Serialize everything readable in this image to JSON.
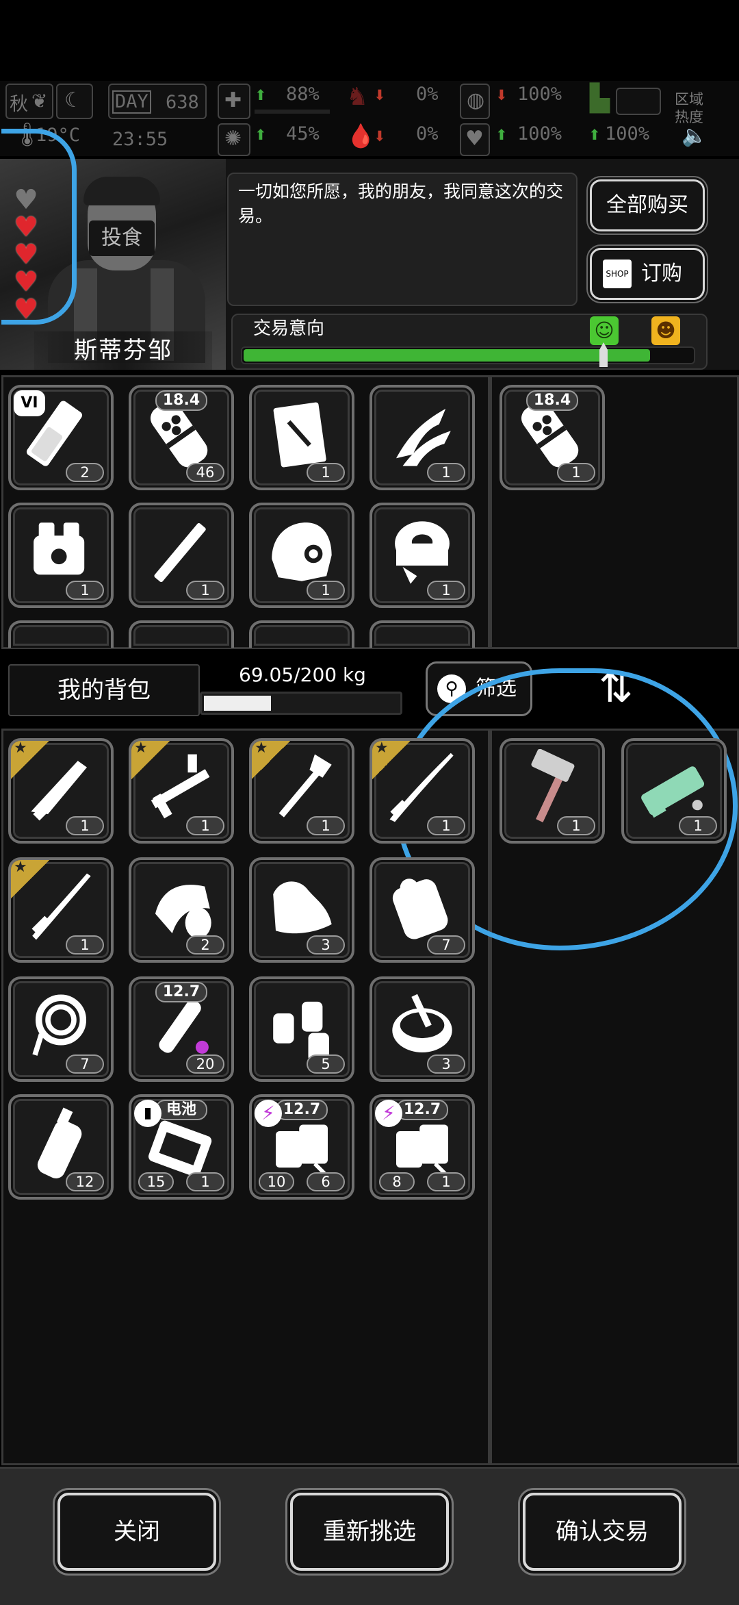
{
  "status": {
    "season": "秋",
    "day_label": "DAY",
    "day": "638",
    "temperature": "19°C",
    "clock": "23:55",
    "stats": {
      "health_pct": "88%",
      "mood_pct": "45%",
      "bleed_pct": "0%",
      "bleed2_pct": "0%",
      "food_pct": "100%",
      "water_pct": "100%",
      "stamina_pct": "100%"
    },
    "zone_label_1": "区域",
    "zone_label_2": "热度"
  },
  "merchant": {
    "name": "斯蒂芬邹",
    "mask_text": "投食",
    "hearts_filled": 4,
    "hearts_total": 5,
    "dialog": "一切如您所愿，我的朋友，我同意这次的交易。",
    "buy_all_label": "全部购买",
    "order_label": "订购",
    "order_icon_text": "SHOP",
    "intent_label": "交易意向",
    "intent_level": 0.9
  },
  "merchant_items": [
    {
      "name": "vial-vi",
      "badge": "VI",
      "count": "2"
    },
    {
      "name": "ammo-18-4",
      "tag": "18.4",
      "count": "46"
    },
    {
      "name": "document",
      "count": "1"
    },
    {
      "name": "claws",
      "count": "1"
    },
    {
      "name": "engine",
      "count": "1"
    },
    {
      "name": "metal-rod",
      "count": "1"
    },
    {
      "name": "helmet",
      "count": "1"
    },
    {
      "name": "spool",
      "count": "1"
    }
  ],
  "merchant_offer": [
    {
      "name": "ammo-18-4",
      "tag": "18.4",
      "count": "1"
    }
  ],
  "backpack": {
    "label": "我的背包",
    "weight": "69.05/200 kg",
    "weight_fraction": 0.3453,
    "filter_label": "筛选"
  },
  "player_items": [
    {
      "name": "machete",
      "starred": true,
      "count": "1"
    },
    {
      "name": "rifle",
      "starred": true,
      "count": "1"
    },
    {
      "name": "shovel",
      "starred": true,
      "count": "1"
    },
    {
      "name": "katana",
      "starred": true,
      "count": "1"
    },
    {
      "name": "sword",
      "starred": true,
      "count": "1"
    },
    {
      "name": "bandage",
      "count": "2"
    },
    {
      "name": "cloth",
      "count": "3"
    },
    {
      "name": "scroll",
      "count": "7"
    },
    {
      "name": "rope",
      "count": "7"
    },
    {
      "name": "bullet-12-7",
      "tag": "12.7",
      "count": "20"
    },
    {
      "name": "spray-bottles",
      "count": "5"
    },
    {
      "name": "bowl",
      "count": "3"
    },
    {
      "name": "bottle",
      "count": "12"
    },
    {
      "name": "battery-pack",
      "tag": "电池",
      "count": "1",
      "count_left": "15"
    },
    {
      "name": "magazine-12-7",
      "tag": "12.7",
      "count": "6",
      "count_left": "10"
    },
    {
      "name": "magazine-12-7-b",
      "tag": "12.7",
      "count": "1",
      "count_left": "8"
    }
  ],
  "player_offer": [
    {
      "name": "hammer",
      "count": "1"
    },
    {
      "name": "plasma-gun",
      "count": "1"
    }
  ],
  "footer": {
    "close_label": "关闭",
    "reselect_label": "重新挑选",
    "confirm_label": "确认交易"
  },
  "colors": {
    "annotation": "#3ea4e6",
    "intent_green": "#3fb535",
    "star_gold": "#c9a436",
    "heart_red": "#e0262d"
  }
}
